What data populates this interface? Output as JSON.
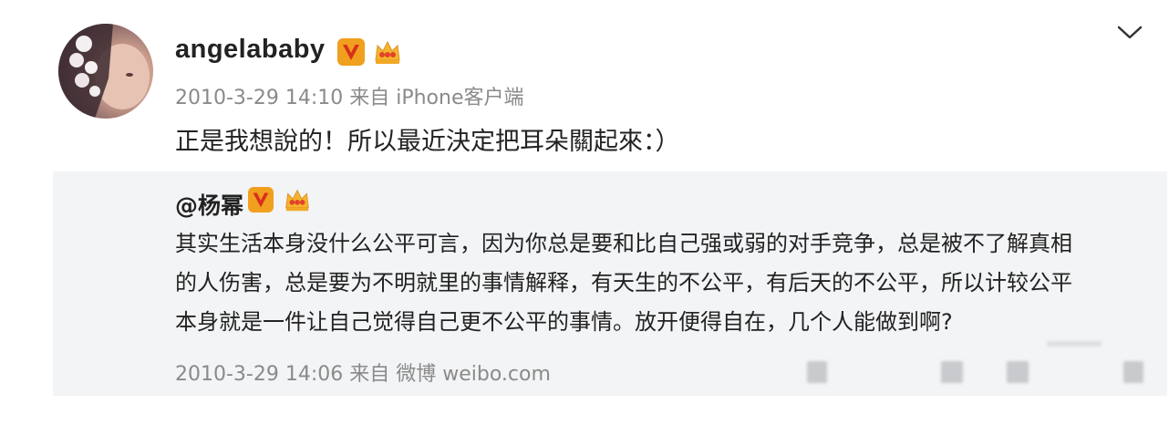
{
  "post": {
    "username": "angelababy",
    "meta": "2010-3-29 14:10 来自 iPhone客户端",
    "content": "正是我想說的！所以最近決定把耳朵關起來：）"
  },
  "repost": {
    "username": "@杨幂",
    "lines": [
      "其实生活本身没什么公平可言，因为你总是要和比自己强或弱的对手竞争，总是被不了解真相",
      "的人伤害，总是要为不明就里的事情解释，有天生的不公平，有后天的不公平，所以计较公平",
      "本身就是一件让自己觉得自己更不公平的事情。放开便得自在，几个人能做到啊?"
    ],
    "meta": "2010-3-29 14:06 来自 微博 weibo.com"
  },
  "icons": {
    "verified": "verified-v-icon",
    "vip": "crown-icon",
    "menu": "chevron-down-icon"
  },
  "colors": {
    "verified_badge": "#f0a01e",
    "vip_crown": "#f5b52a",
    "repost_background": "#f3f4f6",
    "meta_text": "#8a8a8a"
  }
}
